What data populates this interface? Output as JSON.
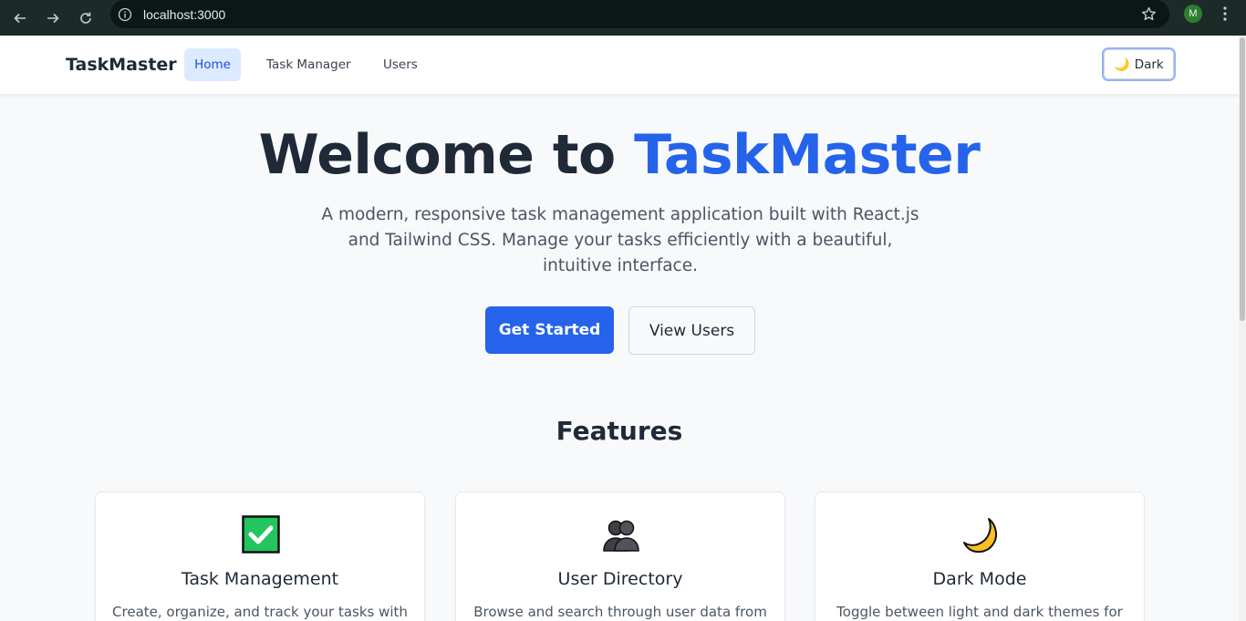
{
  "browser": {
    "url": "localhost:3000",
    "profile_initial": "M"
  },
  "navbar": {
    "brand": "TaskMaster",
    "links": [
      {
        "label": "Home",
        "active": true
      },
      {
        "label": "Task Manager",
        "active": false
      },
      {
        "label": "Users",
        "active": false
      }
    ],
    "theme_toggle": {
      "icon": "moon-icon",
      "label": "Dark"
    }
  },
  "hero": {
    "title_prefix": "Welcome to ",
    "title_accent": "TaskMaster",
    "subtitle": "A modern, responsive task management application built with React.js and Tailwind CSS. Manage your tasks efficiently with a beautiful, intuitive interface.",
    "primary_button": "Get Started",
    "secondary_button": "View Users"
  },
  "features": {
    "title": "Features",
    "cards": [
      {
        "icon": "check-box-icon",
        "title": "Task Management",
        "description": "Create, organize, and track your tasks with"
      },
      {
        "icon": "users-icon",
        "title": "User Directory",
        "description": "Browse and search through user data from"
      },
      {
        "icon": "moon-icon",
        "title": "Dark Mode",
        "description": "Toggle between light and dark themes for"
      }
    ]
  },
  "colors": {
    "accent": "#2563eb",
    "active_nav_bg": "#dbeafe",
    "chrome_bg": "#1c2b28"
  }
}
